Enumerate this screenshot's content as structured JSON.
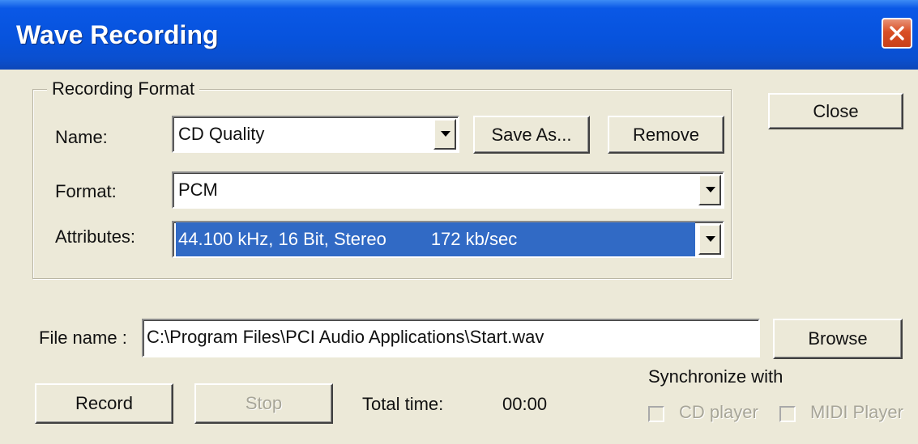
{
  "window": {
    "title": "Wave Recording"
  },
  "group": {
    "legend": "Recording Format",
    "name_label": "Name:",
    "name_value": "CD Quality",
    "save_as_label": "Save As...",
    "remove_label": "Remove",
    "format_label": "Format:",
    "format_value": "PCM",
    "attributes_label": "Attributes:",
    "attributes_value": "44.100 kHz, 16 Bit, Stereo         172 kb/sec"
  },
  "close_label": "Close",
  "file": {
    "label": "File name :",
    "value": "C:\\Program Files\\PCI Audio Applications\\Start.wav",
    "browse_label": "Browse"
  },
  "controls": {
    "record_label": "Record",
    "stop_label": "Stop",
    "total_time_label": "Total time:",
    "total_time_value": "00:00"
  },
  "sync": {
    "label": "Synchronize with",
    "cd_player_label": "CD player",
    "midi_player_label": "MIDI Player"
  },
  "icons": {
    "close": "close-icon",
    "dropdown": "chevron-down-icon"
  },
  "colors": {
    "titlebar": "#0753dd",
    "face": "#ece9d8",
    "selection": "#316ac5",
    "close_button": "#d94f25"
  }
}
